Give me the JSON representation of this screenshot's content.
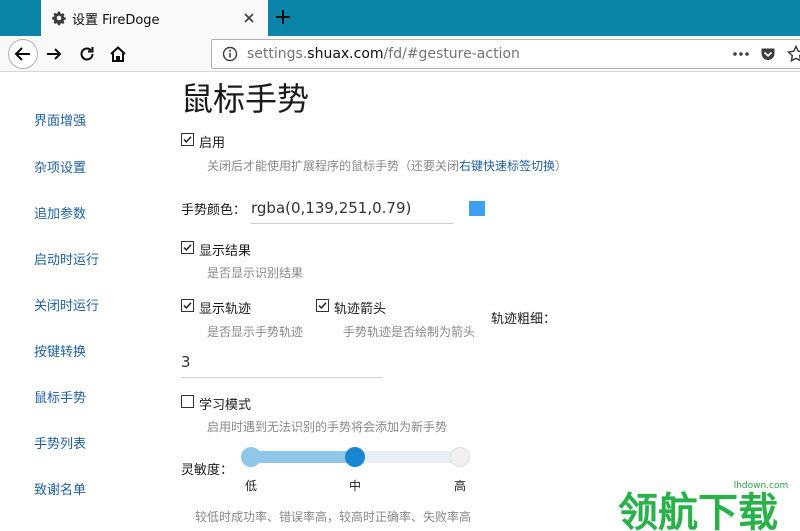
{
  "browser": {
    "tab": {
      "title": "设置 FireDoge",
      "icon": "gear-icon"
    },
    "url": {
      "prefix": "settings.",
      "host": "shuax.com",
      "suffix": "/fd/#gesture-action"
    }
  },
  "sidebar": {
    "items": [
      {
        "label": "界面增强"
      },
      {
        "label": "杂项设置"
      },
      {
        "label": "追加参数"
      },
      {
        "label": "启动时运行"
      },
      {
        "label": "关闭时运行"
      },
      {
        "label": "按键转换"
      },
      {
        "label": "鼠标手势"
      },
      {
        "label": "手势列表"
      },
      {
        "label": "致谢名单"
      }
    ]
  },
  "main": {
    "title": "鼠标手势",
    "enable": {
      "label": "启用",
      "checked": true,
      "hint_before": "关闭后才能使用扩展程序的鼠标手势（还要关闭",
      "hint_link": "右键快速标签切换",
      "hint_after": "）"
    },
    "gesture_color": {
      "label": "手势颜色：",
      "value": "rgba(0,139,251,0.79)",
      "swatch": "#3d9ff0"
    },
    "show_result": {
      "label": "显示结果",
      "checked": true,
      "hint": "是否显示识别结果"
    },
    "show_trail": {
      "label": "显示轨迹",
      "checked": true,
      "hint": "是否显示手势轨迹"
    },
    "trail_arrow": {
      "label": "轨迹箭头",
      "checked": true,
      "hint": "手势轨迹是否绘制为箭头"
    },
    "trail_width": {
      "label": "轨迹粗细：",
      "value": "3"
    },
    "learn_mode": {
      "label": "学习模式",
      "checked": false,
      "hint": "启用时遇到无法识别的手势将会添加为新手势"
    },
    "sensitivity": {
      "label": "灵敏度：",
      "ticks": [
        "低",
        "中",
        "高"
      ],
      "value_index": 1,
      "hint": "较低时成功率、错误率高，较高时正确率、失败率高"
    }
  },
  "watermark": {
    "text": "领航下载",
    "site": "lhdown.com"
  },
  "colors": {
    "accent": "#0a84a8",
    "link": "#1f5fa6",
    "slider": "#1a86d0"
  }
}
